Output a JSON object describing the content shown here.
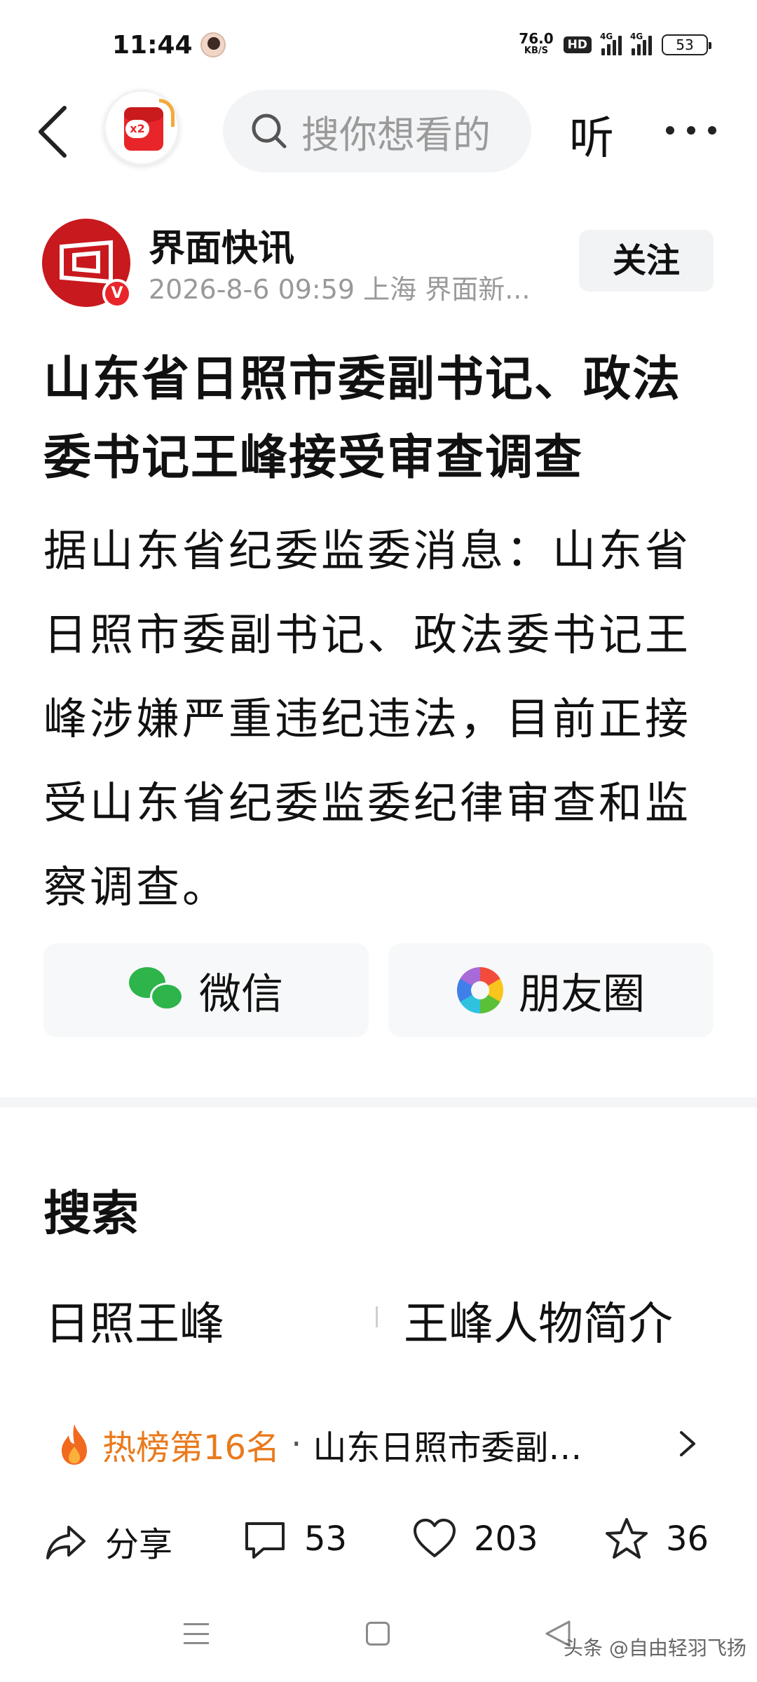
{
  "status_bar": {
    "time": "11:44",
    "net_speed": "76.0",
    "net_unit": "KB/S",
    "hd_badge": "HD",
    "signal1_label": "4G",
    "signal2_label": "4G",
    "battery": "53"
  },
  "nav": {
    "search_placeholder": "搜你想看的",
    "redpacket_badge": "x2",
    "listen_label": "听"
  },
  "author": {
    "name": "界面快讯",
    "meta": "2026-8-6  09:59  上海  界面新...",
    "verified_badge": "V",
    "follow_label": "关注"
  },
  "article": {
    "title": "山东省日照市委副书记、政法委书记王峰接受审查调查",
    "body": "据山东省纪委监委消息：山东省日照市委副书记、政法委书记王峰涉嫌严重违纪违法，目前正接受山东省纪委监委纪律审查和监察调查。"
  },
  "share": {
    "wechat_label": "微信",
    "moments_label": "朋友圈"
  },
  "search_section": {
    "heading": "搜索",
    "suggestions": [
      "日照王峰",
      "王峰人物简介"
    ]
  },
  "hot": {
    "rank": "热榜第16名",
    "dot": "·",
    "text": "山东日照市委副…"
  },
  "actions": {
    "share_label": "分享",
    "comment_count": "53",
    "like_count": "203",
    "favorite_count": "36"
  },
  "watermark": "头条 @自由轻羽飞扬",
  "colors": {
    "accent_red": "#e8262a",
    "hot_orange": "#e97a1d",
    "wechat_green": "#2db44a"
  }
}
